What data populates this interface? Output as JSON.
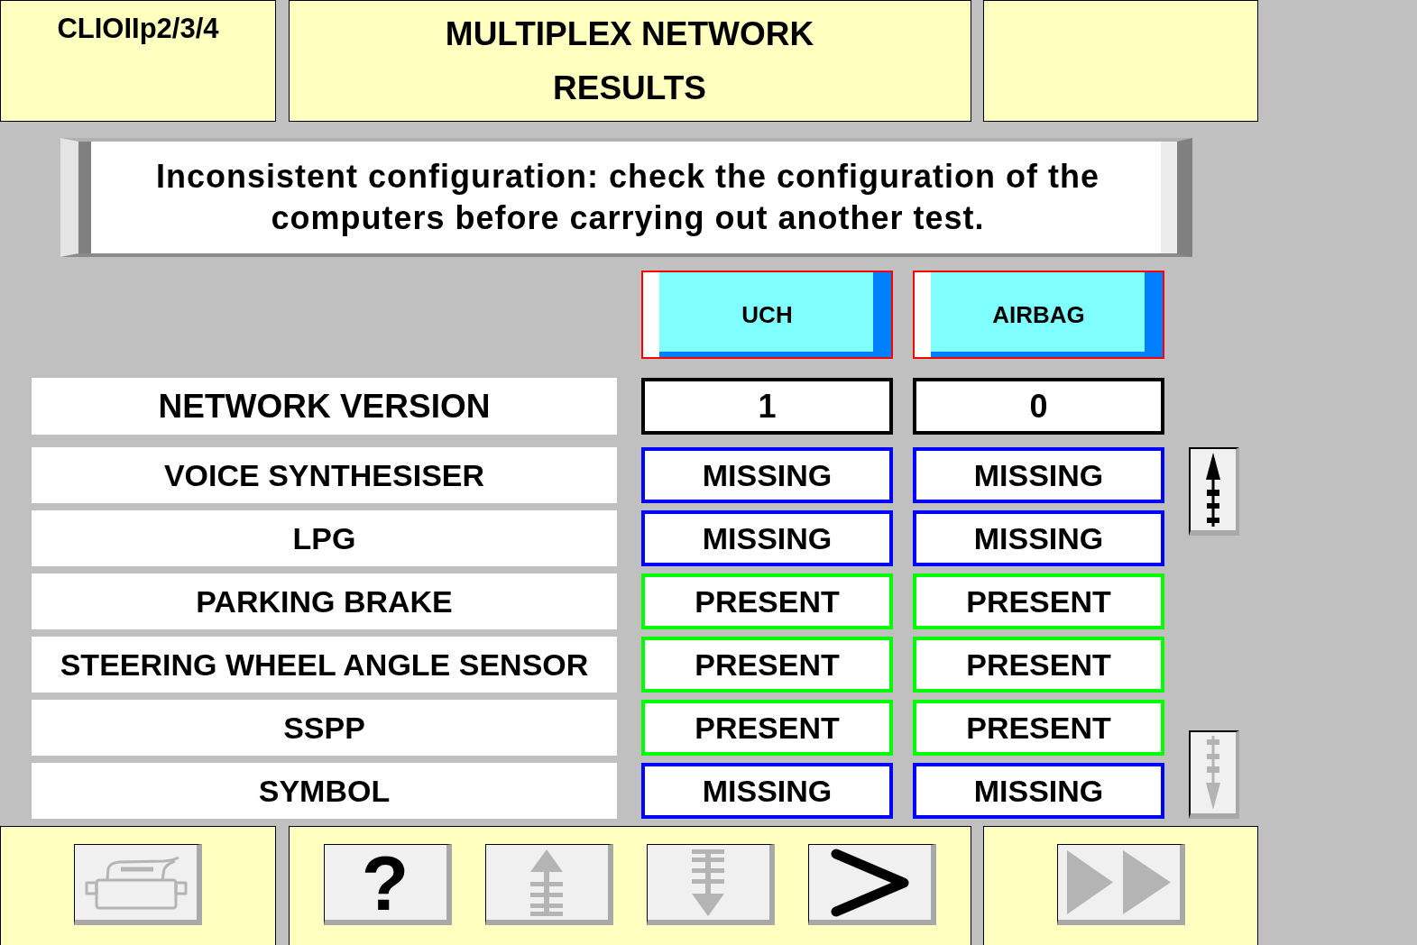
{
  "header": {
    "vehicle": "CLIOIIp2/3/4",
    "title": [
      "MULTIPLEX NETWORK",
      "RESULTS"
    ]
  },
  "message": "Inconsistent configuration: check the configuration of the computers before carrying out another test.",
  "table": {
    "columns": [
      {
        "label": "UCH"
      },
      {
        "label": "AIRBAG"
      }
    ],
    "rows": [
      {
        "kind": "version",
        "label": "NETWORK VERSION",
        "cells": [
          {
            "text": "1"
          },
          {
            "text": "0"
          }
        ]
      },
      {
        "kind": "presence",
        "label": "VOICE SYNTHESISER",
        "cells": [
          {
            "text": "MISSING",
            "present": false
          },
          {
            "text": "MISSING",
            "present": false
          }
        ]
      },
      {
        "kind": "presence",
        "label": "LPG",
        "cells": [
          {
            "text": "MISSING",
            "present": false
          },
          {
            "text": "MISSING",
            "present": false
          }
        ]
      },
      {
        "kind": "presence",
        "label": "PARKING BRAKE",
        "cells": [
          {
            "text": "PRESENT",
            "present": true
          },
          {
            "text": "PRESENT",
            "present": true
          }
        ]
      },
      {
        "kind": "presence",
        "label": "STEERING WHEEL ANGLE SENSOR",
        "cells": [
          {
            "text": "PRESENT",
            "present": true
          },
          {
            "text": "PRESENT",
            "present": true
          }
        ]
      },
      {
        "kind": "presence",
        "label": "SSPP",
        "cells": [
          {
            "text": "PRESENT",
            "present": true
          },
          {
            "text": "PRESENT",
            "present": true
          }
        ]
      },
      {
        "kind": "presence",
        "label": "SYMBOL",
        "cells": [
          {
            "text": "MISSING",
            "present": false
          },
          {
            "text": "MISSING",
            "present": false
          }
        ]
      }
    ]
  },
  "scroll_buttons": [
    {
      "kind": "up",
      "disabled": false
    },
    {
      "kind": "down",
      "disabled": true
    }
  ],
  "toolbar": {
    "panels": [
      {
        "buttons": [
          {
            "kind": "print",
            "disabled": true
          }
        ]
      },
      {
        "buttons": [
          {
            "kind": "help",
            "label": "?",
            "disabled": false
          },
          {
            "kind": "up",
            "disabled": true
          },
          {
            "kind": "down",
            "disabled": true
          },
          {
            "kind": "next",
            "disabled": false
          }
        ]
      },
      {
        "buttons": [
          {
            "kind": "fast_forward",
            "disabled": true
          }
        ]
      }
    ]
  }
}
